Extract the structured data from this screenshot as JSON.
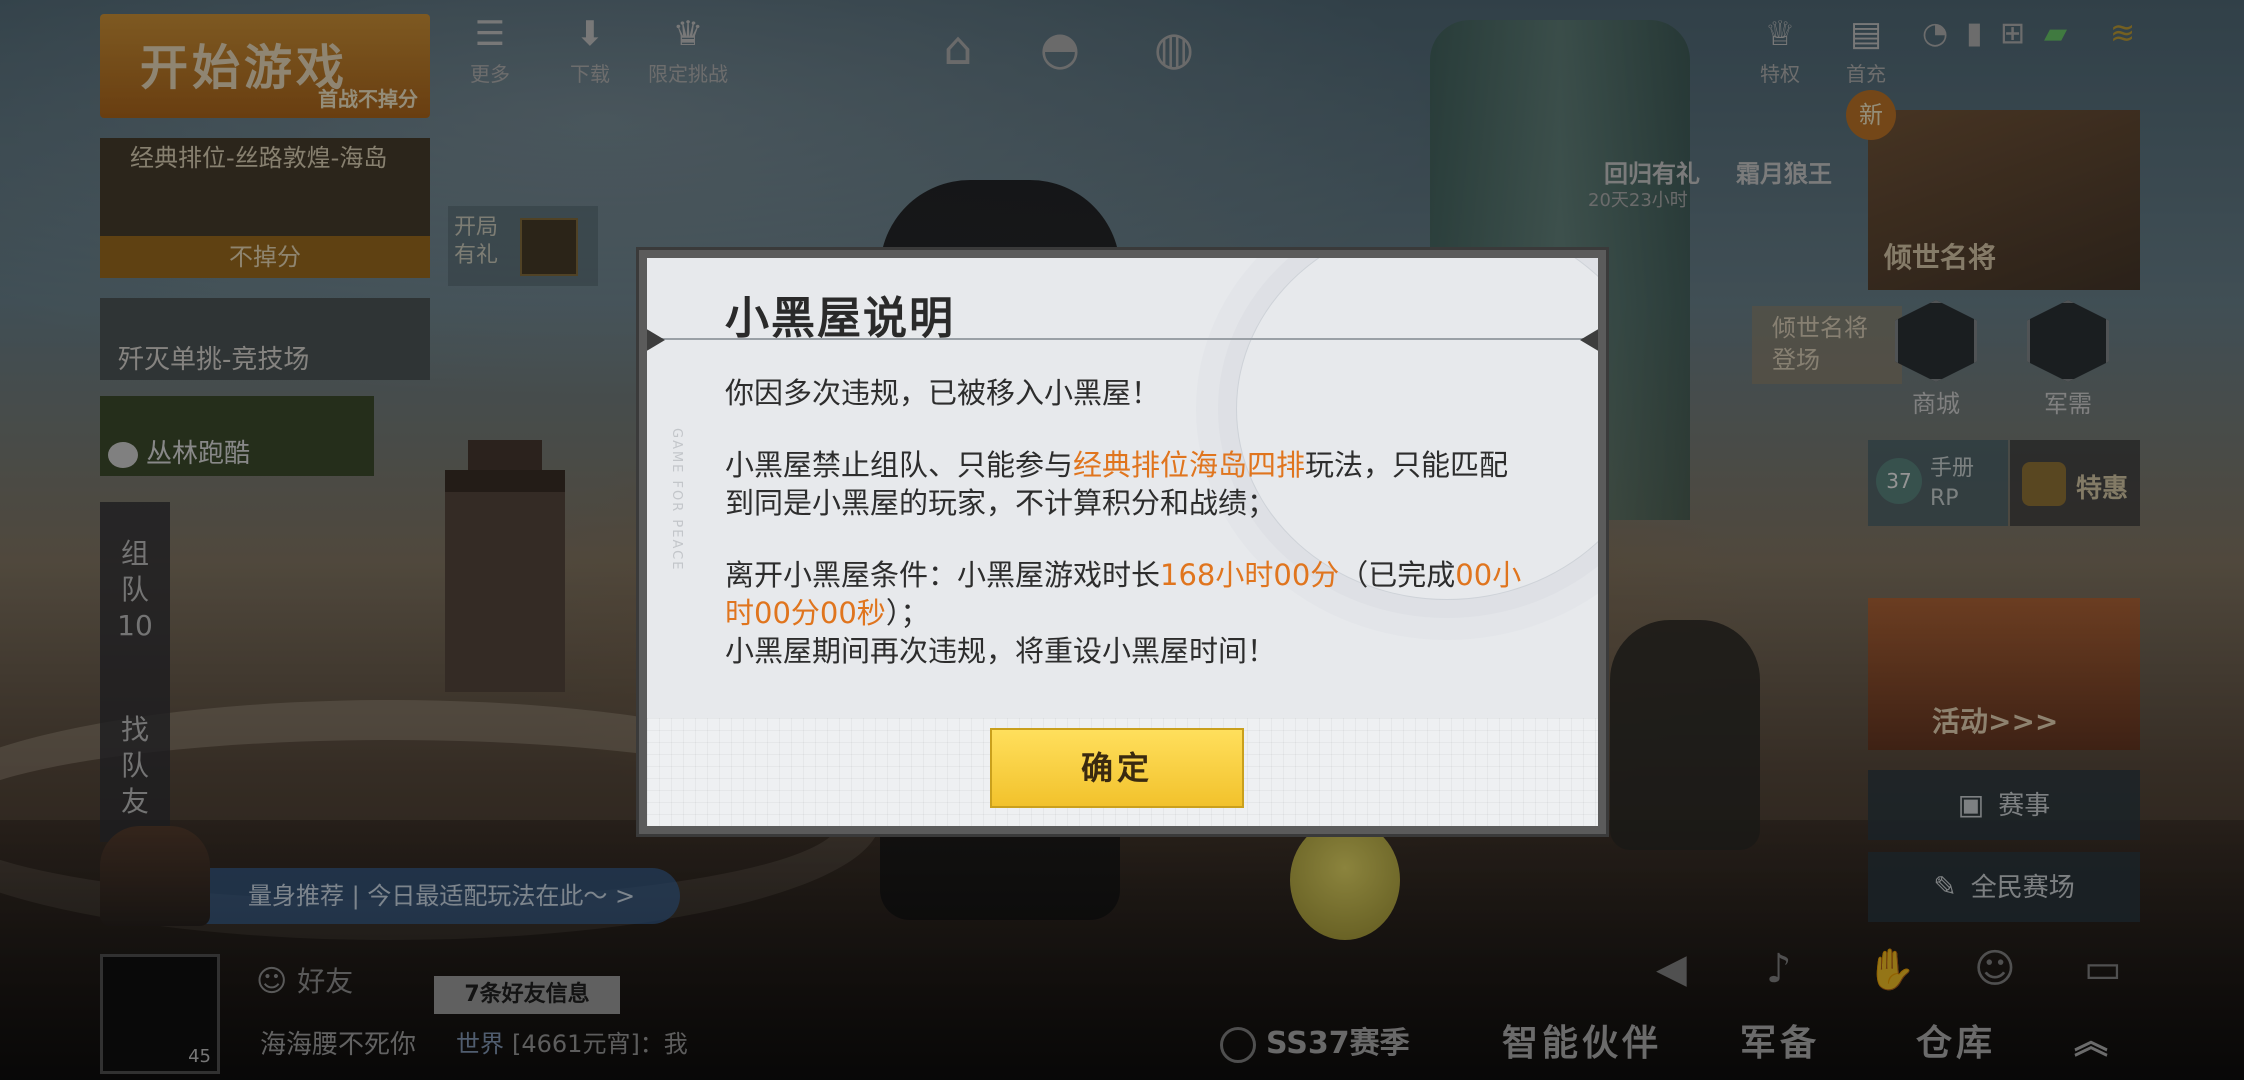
{
  "topbar": {
    "items": [
      {
        "label": "更多",
        "icon": "more-icon"
      },
      {
        "label": "下载",
        "icon": "download-icon"
      },
      {
        "label": "限定挑战",
        "icon": "challenge-icon"
      }
    ],
    "nav_icons": [
      "home-icon",
      "helmet-icon",
      "planet-icon"
    ],
    "right_labels": [
      "特权",
      "首充"
    ]
  },
  "left": {
    "start_title": "开始游戏",
    "start_sub": "首战不掉分",
    "mode_name": "经典排位-丝路敦煌-海岛",
    "mode_bar": "不掉分",
    "open_gift": [
      "开局",
      "有礼"
    ],
    "solo_mode": "歼灭单挑-竞技场",
    "jungle_mode": "丛林跑酷",
    "team_label": [
      "组",
      "队",
      "10"
    ],
    "find_team_label": [
      "找",
      "队",
      "友"
    ]
  },
  "right": {
    "event1": "回归有礼",
    "event2": "霜月狼王",
    "timer": "20天23小时",
    "legend_title": "倾世名将",
    "legend_tag": [
      "倾世名将",
      "登场"
    ],
    "new_badge": "新",
    "shop": "商城",
    "armory": "军需",
    "pass_level": "37",
    "pass_text": [
      "手册",
      "RP"
    ],
    "special": "特惠",
    "activity": "活动>>>",
    "events_btn": "赛事",
    "arena_btn": "全民赛场"
  },
  "bottom": {
    "recommend": "量身推荐 | 今日最适配玩法在此～ >",
    "friends": "好友",
    "msg_badge": "7条好友信息",
    "nickname": "海海腰不死你",
    "avatar_level": "45",
    "world_channel": "世界",
    "world_msg": "[4661元宵]：我",
    "season": "SS37赛季",
    "nav": [
      "智能伙伴",
      "军备",
      "仓库"
    ]
  },
  "modal": {
    "title": "小黑屋说明",
    "watermark": "GAME FOR PEACE",
    "line1": "你因多次违规，已被移入小黑屋！",
    "p2_a": "小黑屋禁止组队、只能参与",
    "p2_hl": "经典排位海岛四排",
    "p2_b": "玩法，只能匹配到同是小黑屋的玩家，不计算积分和战绩；",
    "p3_a": "离开小黑屋条件：小黑屋游戏时长",
    "p3_hl1": "168小时00分",
    "p3_b": "（已完成",
    "p3_hl2": "00小时00分00秒",
    "p3_c": "）；",
    "p4": "小黑屋期间再次违规，将重设小黑屋时间！",
    "confirm": "确定"
  },
  "colors": {
    "highlight": "#e0751e",
    "button": "#f5c935"
  }
}
